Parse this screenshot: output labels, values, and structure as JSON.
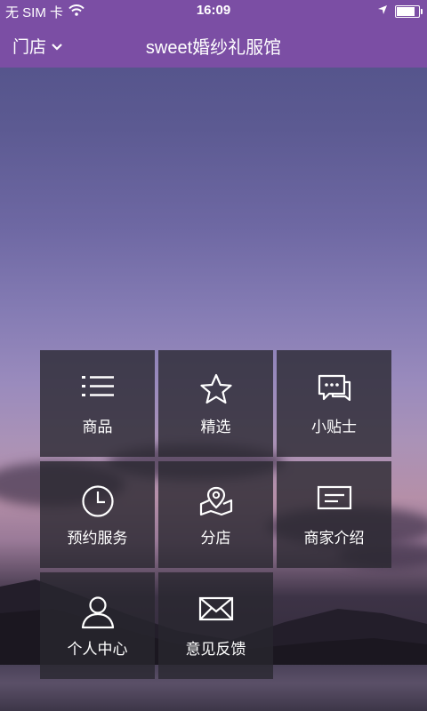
{
  "status_bar": {
    "carrier": "无 SIM 卡",
    "time": "16:09",
    "battery_level": 0.78
  },
  "nav": {
    "store_label": "门店",
    "title": "sweet婚纱礼服馆"
  },
  "menu": [
    {
      "label": "商品",
      "icon": "list-icon"
    },
    {
      "label": "精选",
      "icon": "star-icon"
    },
    {
      "label": "小贴士",
      "icon": "chat-icon"
    },
    {
      "label": "预约服务",
      "icon": "clock-icon"
    },
    {
      "label": "分店",
      "icon": "map-icon"
    },
    {
      "label": "商家介绍",
      "icon": "message-card-icon"
    },
    {
      "label": "个人中心",
      "icon": "user-icon"
    },
    {
      "label": "意见反馈",
      "icon": "mail-icon"
    }
  ],
  "colors": {
    "brand": "#7b4ea4",
    "tile_bg": "rgba(40,38,46,0.78)"
  }
}
